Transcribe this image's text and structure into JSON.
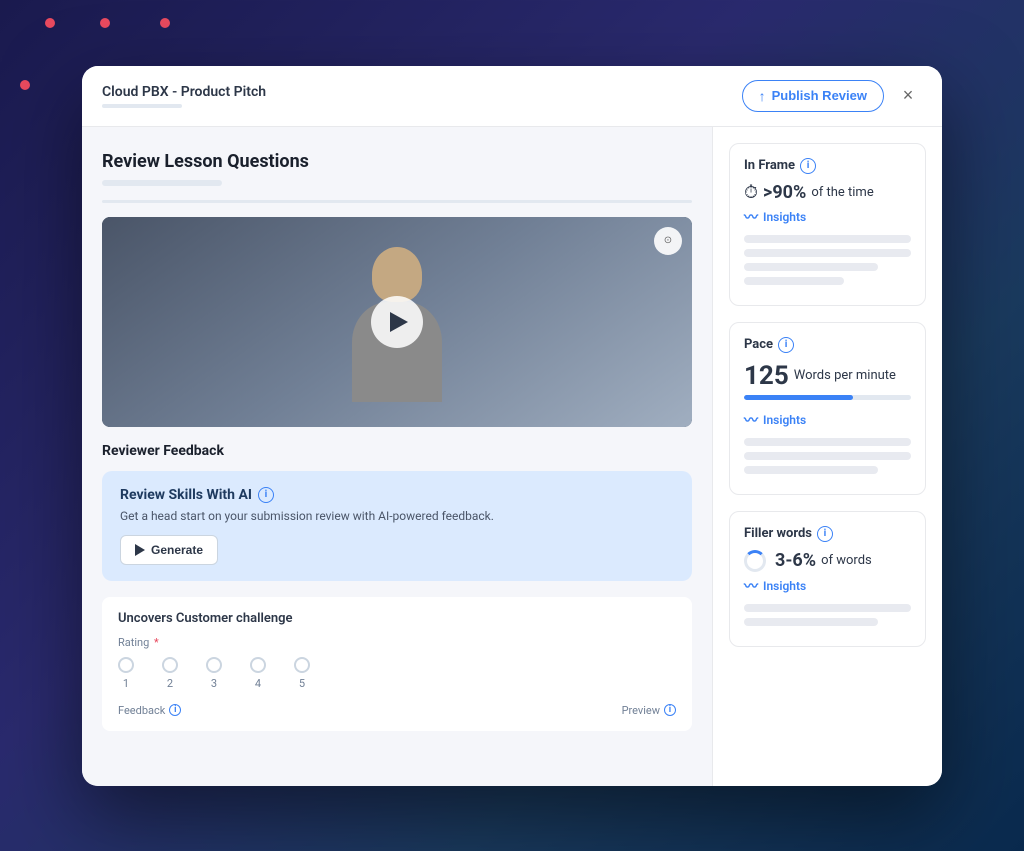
{
  "decorative": {
    "dots": [
      "dot1",
      "dot2",
      "dot3",
      "dot4"
    ]
  },
  "modal": {
    "title": "Cloud PBX - Product Pitch",
    "publish_btn": "Publish Review",
    "close_btn": "×"
  },
  "left_panel": {
    "section_title": "Review Lesson Questions",
    "reviewer_feedback_label": "Reviewer Feedback",
    "ai_panel": {
      "title": "Review Skills With AI",
      "description": "Get a head start on your submission review with AI-powered feedback.",
      "generate_btn": "Generate"
    },
    "question": {
      "title": "Uncovers Customer challenge",
      "rating_label": "Rating",
      "rating_options": [
        1,
        2,
        3,
        4,
        5
      ],
      "feedback_label": "Feedback",
      "preview_label": "Preview"
    }
  },
  "right_panel": {
    "in_frame": {
      "title": "In Frame",
      "value": ">90%",
      "unit": "of the time",
      "insights_label": "Insights"
    },
    "pace": {
      "title": "Pace",
      "value": "125",
      "unit": "Words per minute",
      "bar_percent": 65,
      "insights_label": "Insights"
    },
    "filler_words": {
      "title": "Filler words",
      "value": "3-6%",
      "unit": "of words",
      "insights_label": "Insights"
    }
  }
}
